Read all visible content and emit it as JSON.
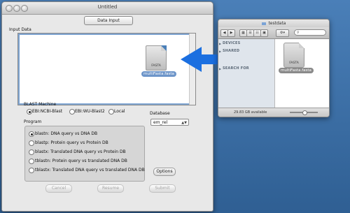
{
  "main_window": {
    "title": "Untitled",
    "segment_label": "Data Input",
    "input_data_label": "Input Data",
    "dropped_file": {
      "type": "FASTA",
      "name": "multiFasta.fasta"
    },
    "blast_machine": {
      "label": "BLAST Machine",
      "options": [
        "EBI:NCBI-Blast",
        "EBI:WU-Blast2",
        "Local"
      ],
      "selected": "EBI:NCBI-Blast"
    },
    "database": {
      "label": "Database",
      "value": "em_rel"
    },
    "program": {
      "label": "Program",
      "options": [
        "blastn: DNA query vs DNA DB",
        "blastp: Protein query vs Protein DB",
        "blastx: Translated DNA query vs Protein DB",
        "tblastn: Protein query vs translated DNA DB",
        "tblastx: Translated DNA query vs translated DNA DB"
      ],
      "selected": "blastn: DNA query vs DNA DB"
    },
    "options_label": "Options",
    "buttons": {
      "cancel": "Cancel",
      "resume": "Resume",
      "submit": "Submit"
    }
  },
  "finder_window": {
    "title": "testdata",
    "sidebar": [
      "DEVICES",
      "SHARED",
      "SEARCH FOR"
    ],
    "file": {
      "type": "FASTA",
      "name": "multiFasta.fasta"
    },
    "status": "29.83 GB available"
  },
  "colors": {
    "desktop": "#3b6ea5",
    "arrow": "#1b6fe0",
    "selection": "#6d95c9"
  },
  "icons": [
    "close-icon",
    "minimize-icon",
    "zoom-icon",
    "file-icon",
    "drag-arrow-icon",
    "back-icon",
    "forward-icon",
    "folder-icon",
    "gear-icon",
    "search-icon"
  ]
}
